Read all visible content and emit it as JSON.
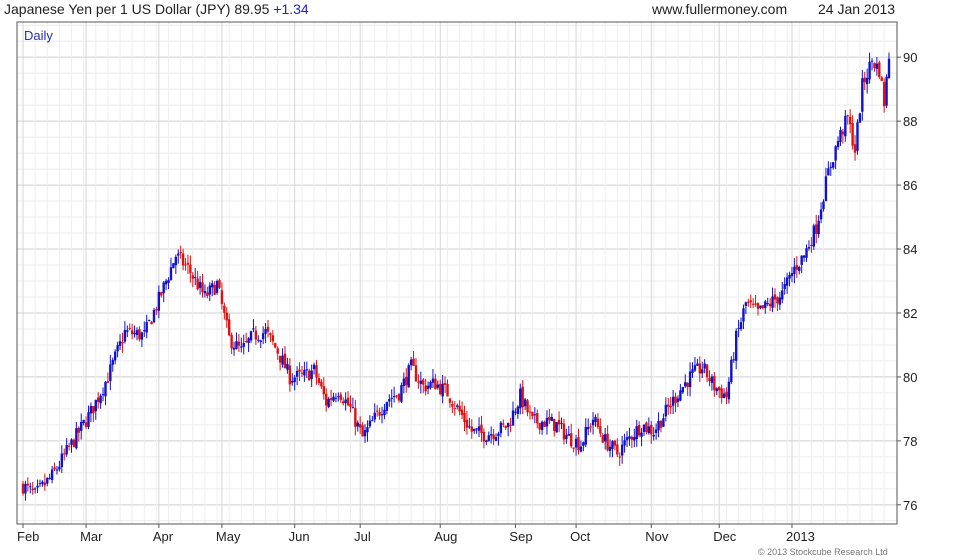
{
  "header": {
    "title": "Japanese Yen per 1 US Dollar (JPY)",
    "last_value": "89.95",
    "change": "+1.34",
    "site": "www.fullermoney.com",
    "date": "24 Jan 2013"
  },
  "colors": {
    "up": "#1111cc",
    "down": "#dd1111",
    "grid": "#d8d8d8",
    "frame": "#555555"
  },
  "chart_data": {
    "type": "candlestick",
    "title": "Japanese Yen per 1 US Dollar (JPY)",
    "period_label": "Daily",
    "copyright": "© 2013 Stockcube Research Ltd",
    "x_labels": [
      "Feb",
      "Mar",
      "Apr",
      "May",
      "Jun",
      "Jul",
      "Aug",
      "Sep",
      "Oct",
      "Nov",
      "Dec",
      "2013"
    ],
    "y_ticks": [
      76,
      78,
      80,
      82,
      84,
      86,
      88,
      90
    ],
    "ylim": [
      75.4,
      91.1
    ],
    "grid": true,
    "y_axis_side": "right",
    "close_path": [
      [
        0,
        76.6
      ],
      [
        5,
        76.3
      ],
      [
        12,
        76.9
      ],
      [
        20,
        77.9
      ],
      [
        28,
        78.9
      ],
      [
        35,
        80.0
      ],
      [
        42,
        81.4
      ],
      [
        50,
        81.3
      ],
      [
        57,
        82.6
      ],
      [
        63,
        83.8
      ],
      [
        68,
        83.4
      ],
      [
        75,
        82.5
      ],
      [
        80,
        82.9
      ],
      [
        85,
        81.2
      ],
      [
        90,
        80.8
      ],
      [
        95,
        81.3
      ],
      [
        100,
        81.4
      ],
      [
        105,
        80.8
      ],
      [
        110,
        80.0
      ],
      [
        115,
        80.0
      ],
      [
        120,
        80.2
      ],
      [
        125,
        79.2
      ],
      [
        130,
        79.6
      ],
      [
        135,
        79.0
      ],
      [
        140,
        78.1
      ],
      [
        145,
        78.7
      ],
      [
        150,
        79.3
      ],
      [
        155,
        79.5
      ],
      [
        160,
        80.3
      ],
      [
        165,
        79.7
      ],
      [
        170,
        79.8
      ],
      [
        175,
        79.5
      ],
      [
        180,
        78.9
      ],
      [
        185,
        78.3
      ],
      [
        190,
        78.2
      ],
      [
        195,
        78.3
      ],
      [
        200,
        78.5
      ],
      [
        205,
        79.4
      ],
      [
        210,
        78.6
      ],
      [
        215,
        78.6
      ],
      [
        220,
        78.5
      ],
      [
        225,
        78.1
      ],
      [
        230,
        77.9
      ],
      [
        235,
        78.7
      ],
      [
        240,
        78.0
      ],
      [
        245,
        77.6
      ],
      [
        250,
        78.1
      ],
      [
        255,
        78.5
      ],
      [
        260,
        78.3
      ],
      [
        265,
        78.9
      ],
      [
        270,
        79.5
      ],
      [
        275,
        80.0
      ],
      [
        280,
        80.3
      ],
      [
        285,
        79.7
      ],
      [
        290,
        79.4
      ],
      [
        294,
        81.2
      ],
      [
        298,
        82.3
      ],
      [
        303,
        82.0
      ],
      [
        308,
        82.3
      ],
      [
        313,
        82.6
      ],
      [
        318,
        83.4
      ],
      [
        322,
        83.8
      ],
      [
        327,
        84.7
      ],
      [
        332,
        86.4
      ],
      [
        336,
        87.4
      ],
      [
        340,
        88.1
      ],
      [
        343,
        87.1
      ],
      [
        346,
        89.1
      ],
      [
        350,
        89.9
      ],
      [
        353,
        89.6
      ],
      [
        355,
        88.6
      ],
      [
        357,
        89.95
      ]
    ],
    "x_label_days": [
      0,
      26,
      56,
      82,
      112,
      139,
      172,
      203,
      228,
      259,
      287,
      317
    ]
  }
}
